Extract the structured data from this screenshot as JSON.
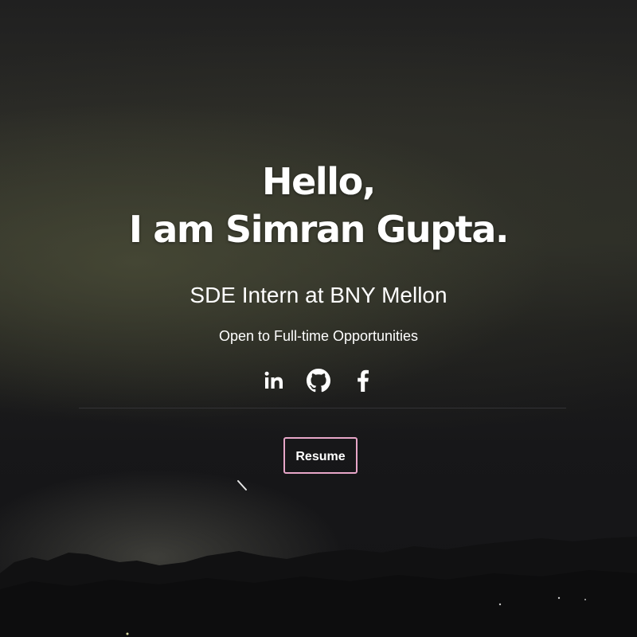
{
  "hero": {
    "greeting": "Hello,",
    "name_line": "I am Simran Gupta.",
    "role": "SDE Intern at BNY Mellon",
    "status": "Open to Full-time Opportunities"
  },
  "social": {
    "links": [
      {
        "name": "linkedin",
        "icon": "linkedin-icon"
      },
      {
        "name": "github",
        "icon": "github-icon"
      },
      {
        "name": "facebook",
        "icon": "facebook-icon"
      }
    ]
  },
  "actions": {
    "resume_label": "Resume"
  },
  "colors": {
    "text": "#ffffff",
    "button_border": "#e7a6c8",
    "divider": "#333336",
    "background_dark": "#161618"
  }
}
